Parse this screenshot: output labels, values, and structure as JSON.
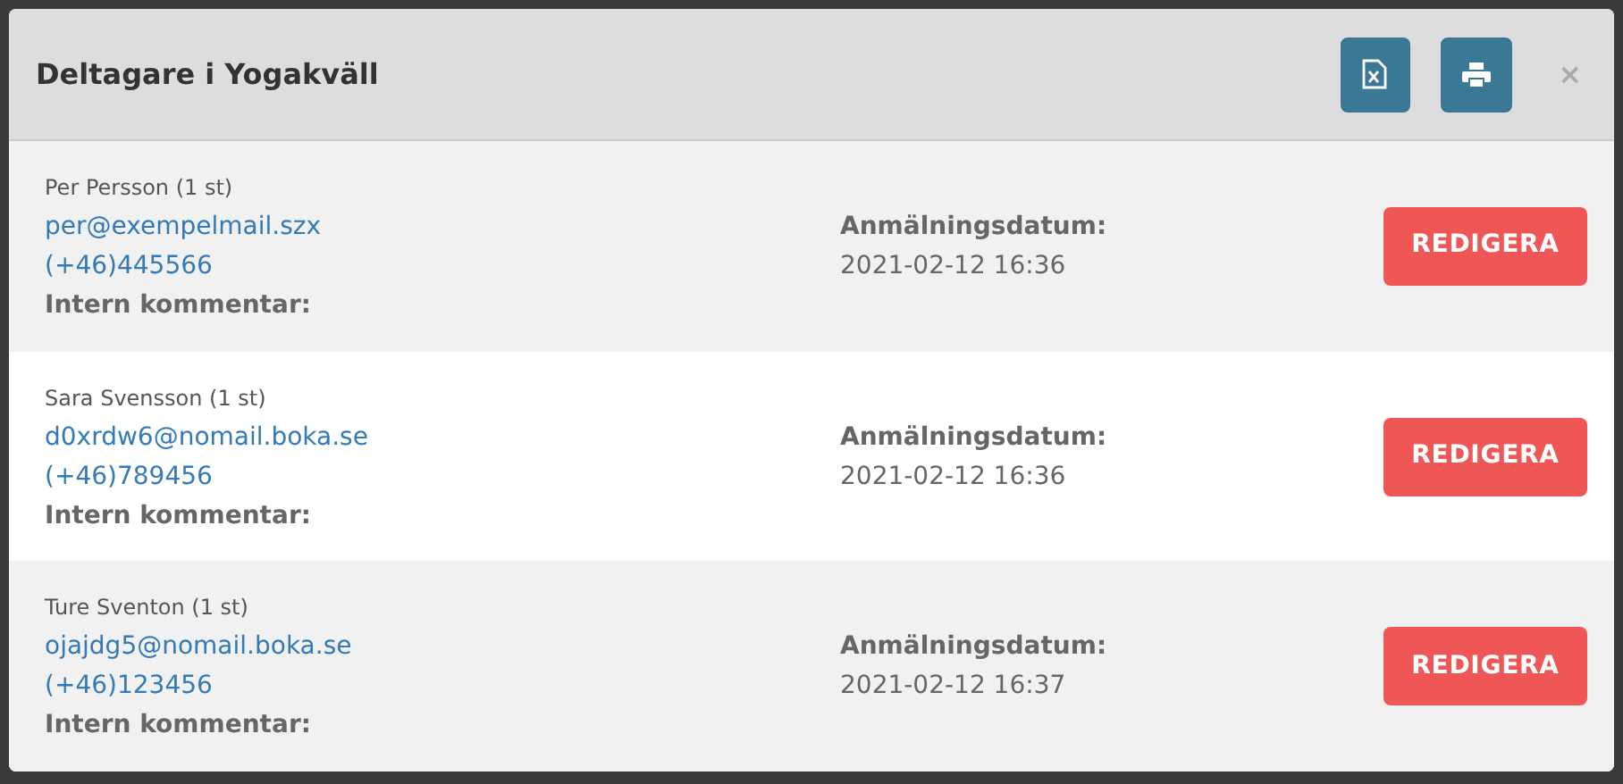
{
  "modal": {
    "title": "Deltagare i Yogakväll",
    "close": "×"
  },
  "participants": [
    {
      "name": "Per Persson (1 st)",
      "email": "per@exempelmail.szx",
      "phone": "(+46)445566",
      "comment_label": "Intern kommentar:",
      "date_label": "Anmälningsdatum:",
      "date": "2021-02-12 16:36",
      "button": "REDIGERA"
    },
    {
      "name": "Sara Svensson (1 st)",
      "email": "d0xrdw6@nomail.boka.se",
      "phone": "(+46)789456",
      "comment_label": "Intern kommentar:",
      "date_label": "Anmälningsdatum:",
      "date": "2021-02-12 16:36",
      "button": "REDIGERA"
    },
    {
      "name": "Ture Sventon (1 st)",
      "email": "ojajdg5@nomail.boka.se",
      "phone": "(+46)123456",
      "comment_label": "Intern kommentar:",
      "date_label": "Anmälningsdatum:",
      "date": "2021-02-12 16:37",
      "button": "REDIGERA"
    }
  ]
}
